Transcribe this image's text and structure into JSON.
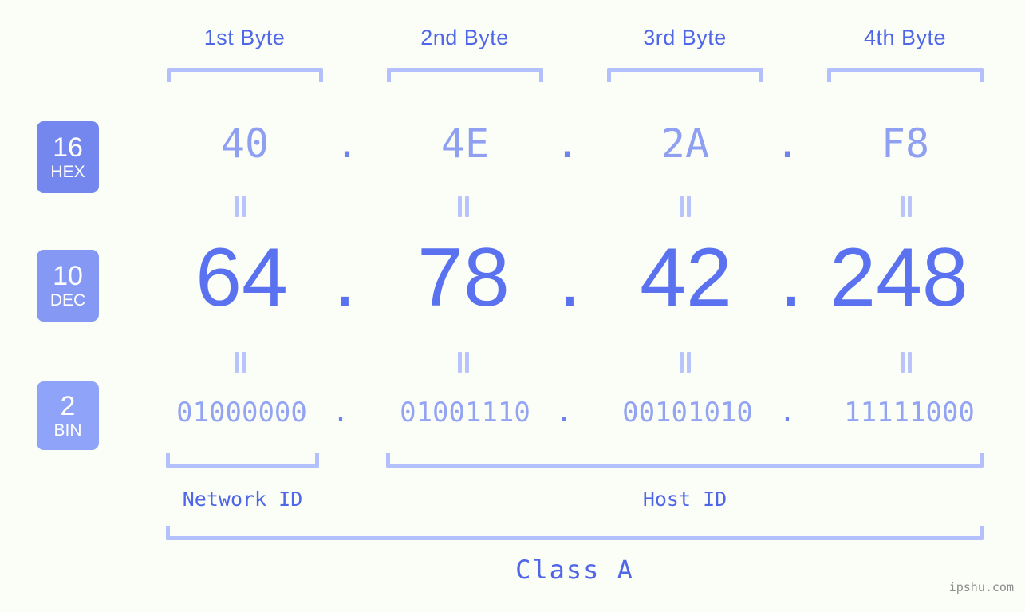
{
  "meta": {
    "background": "#fbfdf7",
    "accent": "#4f66e8",
    "bracket_color": "#b4c0fb"
  },
  "headers": [
    {
      "label": "1st Byte"
    },
    {
      "label": "2nd Byte"
    },
    {
      "label": "3rd Byte"
    },
    {
      "label": "4th Byte"
    }
  ],
  "bases": [
    {
      "number": "16",
      "name": "HEX",
      "color": "#7487ef"
    },
    {
      "number": "10",
      "name": "DEC",
      "color": "#8598f4"
    },
    {
      "number": "2",
      "name": "BIN",
      "color": "#8fa3f8"
    }
  ],
  "rows": {
    "hex": {
      "values": [
        "40",
        "4E",
        "2A",
        "F8"
      ],
      "separator": "."
    },
    "dec": {
      "values": [
        "64",
        "78",
        "42",
        "248"
      ],
      "separator": "."
    },
    "bin": {
      "values": [
        "01000000",
        "01001110",
        "00101010",
        "11111000"
      ],
      "separator": "."
    }
  },
  "equals_marks": {
    "symbol": "=",
    "count_per_row": 4,
    "rows": 2
  },
  "segments": [
    {
      "label": "Network ID"
    },
    {
      "label": "Host ID"
    }
  ],
  "class": {
    "label": "Class A"
  },
  "watermark": {
    "text": "ipshu.com"
  },
  "chart_data": {
    "type": "table",
    "title": "IP address byte breakdown",
    "address_hex": "40.4E.2A.F8",
    "address_dec": "64.78.42.248",
    "address_bin": "01000000.01001110.00101010.11111000",
    "columns": [
      "1st Byte",
      "2nd Byte",
      "3rd Byte",
      "4th Byte"
    ],
    "rows": [
      {
        "base": "16",
        "name": "HEX",
        "values": [
          "40",
          "4E",
          "2A",
          "F8"
        ]
      },
      {
        "base": "10",
        "name": "DEC",
        "values": [
          "64",
          "78",
          "42",
          "248"
        ]
      },
      {
        "base": "2",
        "name": "BIN",
        "values": [
          "01000000",
          "01001110",
          "00101010",
          "11111000"
        ]
      }
    ],
    "network_id_bytes": 1,
    "host_id_bytes": 3,
    "ip_class": "Class A"
  }
}
